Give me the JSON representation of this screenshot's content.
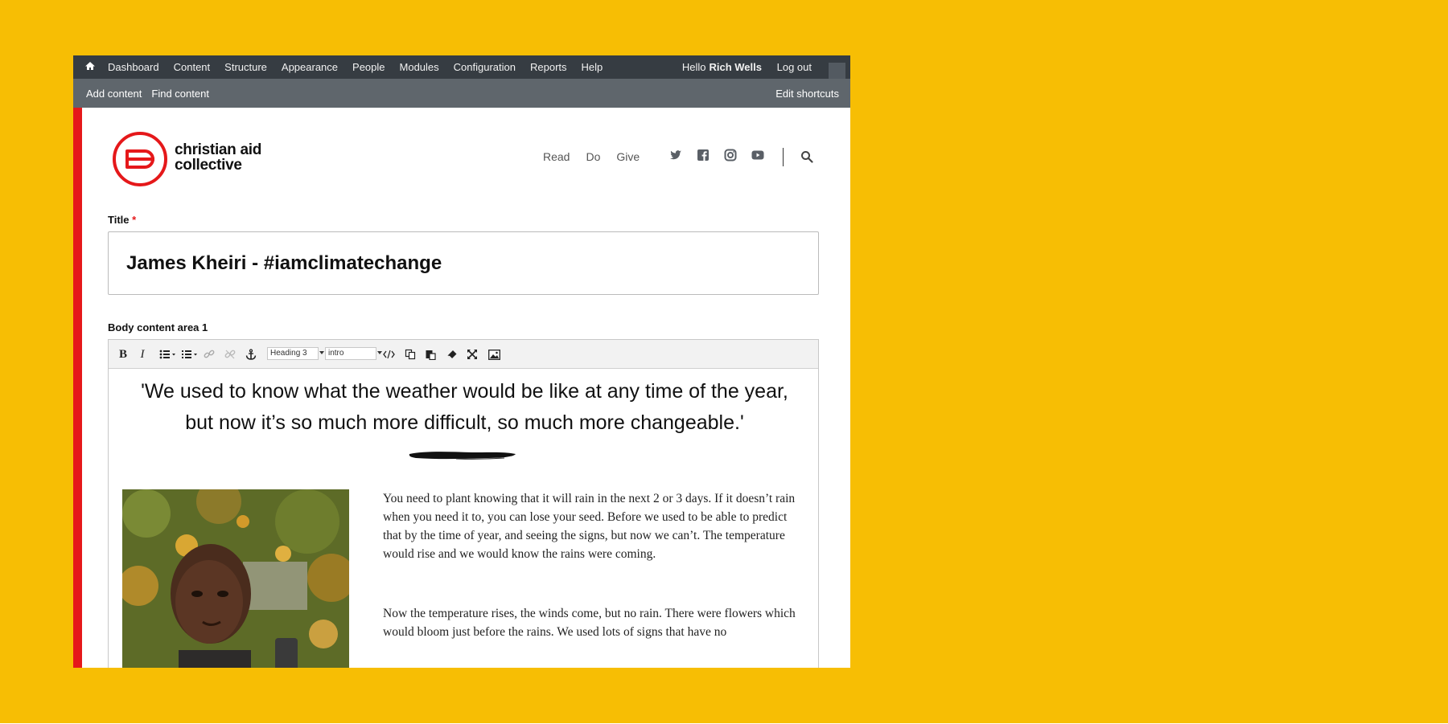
{
  "admin_toolbar": {
    "menu": [
      "Dashboard",
      "Content",
      "Structure",
      "Appearance",
      "People",
      "Modules",
      "Configuration",
      "Reports",
      "Help"
    ],
    "greeting": "Hello",
    "user_name": "Rich Wells",
    "logout": "Log out"
  },
  "shortcuts": {
    "items": [
      "Add content",
      "Find content"
    ],
    "edit": "Edit shortcuts"
  },
  "site": {
    "logo_line1": "christian aid",
    "logo_line2": "collective",
    "nav": [
      "Read",
      "Do",
      "Give"
    ],
    "social_icons": [
      "twitter-icon",
      "facebook-icon",
      "instagram-icon",
      "youtube-icon"
    ]
  },
  "form": {
    "title_label": "Title",
    "required_mark": "*",
    "title_value": "James Kheiri - #iamclimatechange",
    "body_label": "Body content area 1"
  },
  "editor": {
    "format_select": "Heading 3",
    "style_select": "intro",
    "quote": "'We used to know what the weather would be like at any time of the year, but now it’s so much more difficult, so much more changeable.'",
    "paragraph1": "You need to plant knowing that it will rain in the next 2 or 3 days. If it doesn’t rain when you need it to, you can lose your seed. Before we used to be able to predict that by the time of year, and seeing the signs, but now we can’t. The temperature would rise and we would know the rains were coming.",
    "paragraph2": "Now the temperature rises, the winds come, but no rain. There were flowers which would bloom just before the rains. We used lots of signs that have no"
  },
  "colors": {
    "background": "#f7be04",
    "admin_bar": "#363c42",
    "shortcut_bar": "#5f666c",
    "brand_red": "#e5181a"
  }
}
